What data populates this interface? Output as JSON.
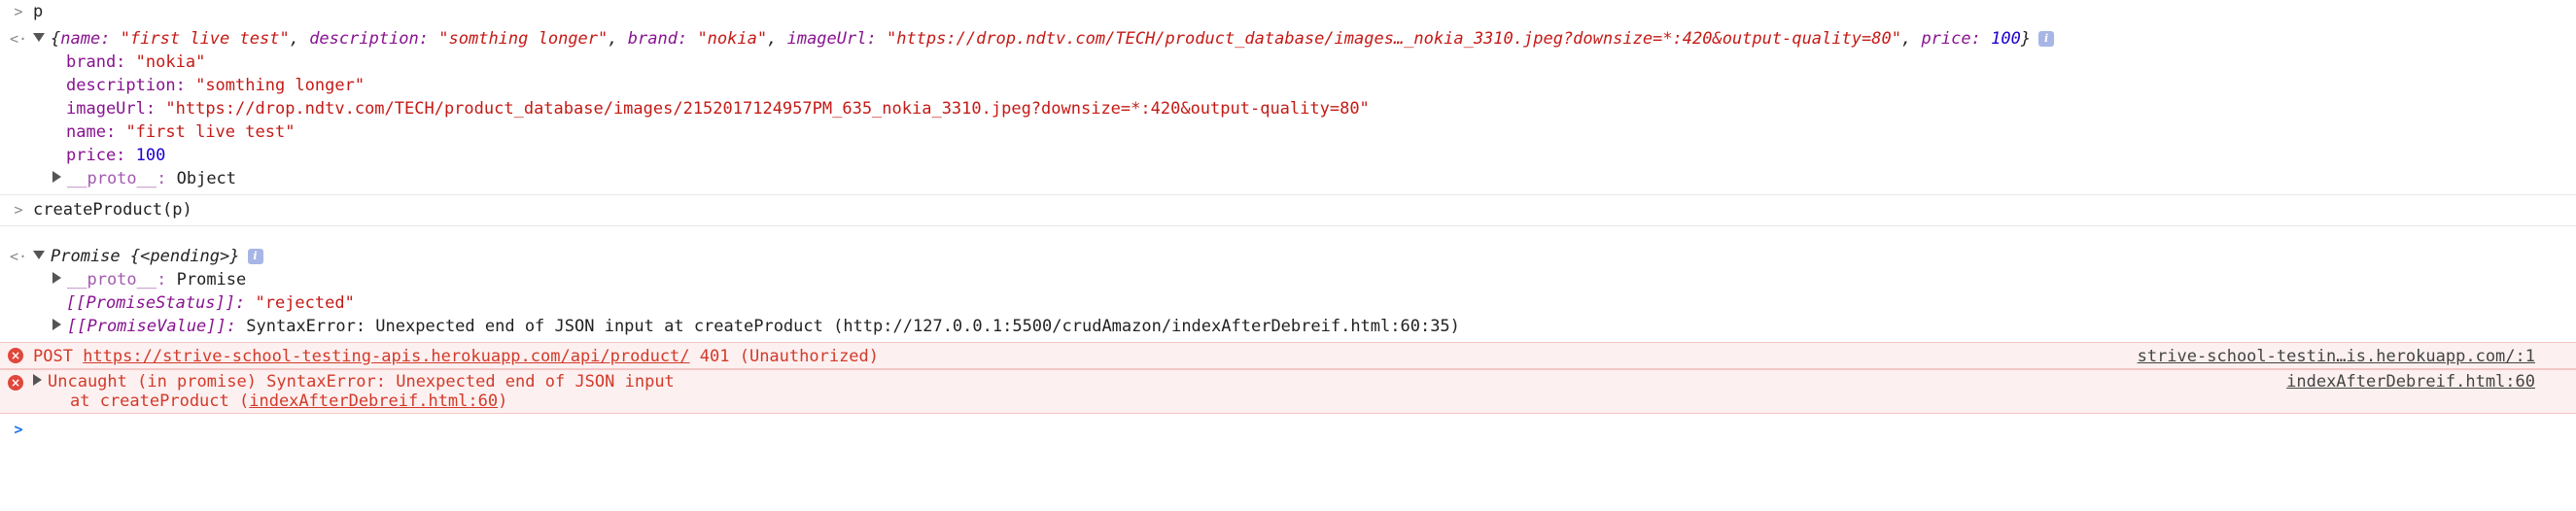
{
  "console": {
    "entries": {
      "input1": {
        "prompt": ">",
        "code": "p"
      },
      "output1": {
        "return_arrow": "<·",
        "summary": {
          "open": "{",
          "name_key": "name:",
          "name_val": "\"first live test\"",
          "desc_key": "description:",
          "desc_val": "\"somthing longer\"",
          "brand_key": "brand:",
          "brand_val": "\"nokia\"",
          "img_key": "imageUrl:",
          "img_val": "\"https://drop.ndtv.com/TECH/product_database/images…_nokia_3310.jpeg?downsize=*:420&output-quality=80\"",
          "price_key": "price:",
          "price_val": "100",
          "close": "}",
          "comma": ","
        },
        "info_badge": "i",
        "props": {
          "brand_key": "brand:",
          "brand_val": "\"nokia\"",
          "description_key": "description:",
          "description_val": "\"somthing longer\"",
          "imageUrl_key": "imageUrl:",
          "imageUrl_val": "\"https://drop.ndtv.com/TECH/product_database/images/2152017124957PM_635_nokia_3310.jpeg?downsize=*:420&output-quality=80\"",
          "name_key": "name:",
          "name_val": "\"first live test\"",
          "price_key": "price:",
          "price_val": "100",
          "proto_key": "__proto__:",
          "proto_val": "Object"
        }
      },
      "input2": {
        "prompt": ">",
        "code": "createProduct(p)"
      },
      "output2": {
        "return_arrow": "<·",
        "promise_label": "Promise",
        "promise_state": "{<pending>}",
        "info_badge": "i",
        "proto_key": "__proto__:",
        "proto_val": "Promise",
        "status_key": "[[PromiseStatus]]:",
        "status_val": "\"rejected\"",
        "value_key": "[[PromiseValue]]:",
        "value_val": "SyntaxError: Unexpected end of JSON input at createProduct (http://127.0.0.1:5500/crudAmazon/indexAfterDebreif.html:60:35)"
      },
      "error1": {
        "icon": "×",
        "method": "POST",
        "url": "https://strive-school-testing-apis.herokuapp.com/api/product/",
        "status": "401 (Unauthorized)",
        "source": "strive-school-testin…is.herokuapp.com/:1"
      },
      "error2": {
        "icon": "×",
        "message": "Uncaught (in promise) SyntaxError: Unexpected end of JSON input",
        "stack_prefix": "at createProduct (",
        "stack_link": "indexAfterDebreif.html:60",
        "stack_suffix": ")",
        "source": "indexAfterDebreif.html:60"
      },
      "prompt": {
        "caret": ">"
      }
    }
  }
}
